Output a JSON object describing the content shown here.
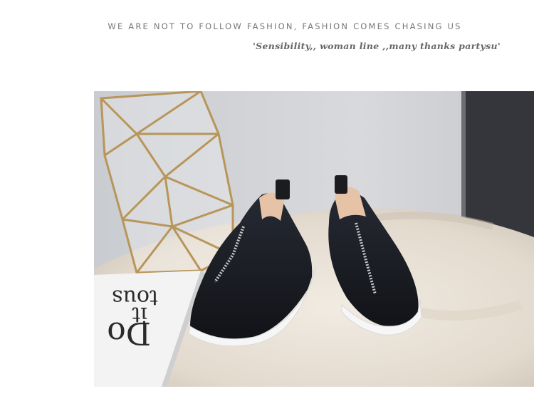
{
  "header": {
    "tagline": "WE ARE NOT TO FOLLOW FASHION, FASHION COMES CHASING US",
    "script_line": "'Sensibility,, woman line ,,many thanks partysu'"
  },
  "photo": {
    "magazine_text_line1": "tous",
    "magazine_text_line2": "it",
    "magazine_text_line3": "Do",
    "colors": {
      "wall": "#cfd1d4",
      "dark_panel": "#3a3b3f",
      "rug": "#e9e1d6",
      "shoe": "#1c1e24",
      "sole": "#ffffff",
      "lining": "#e6c2a6",
      "brass": "#b8955a"
    }
  }
}
